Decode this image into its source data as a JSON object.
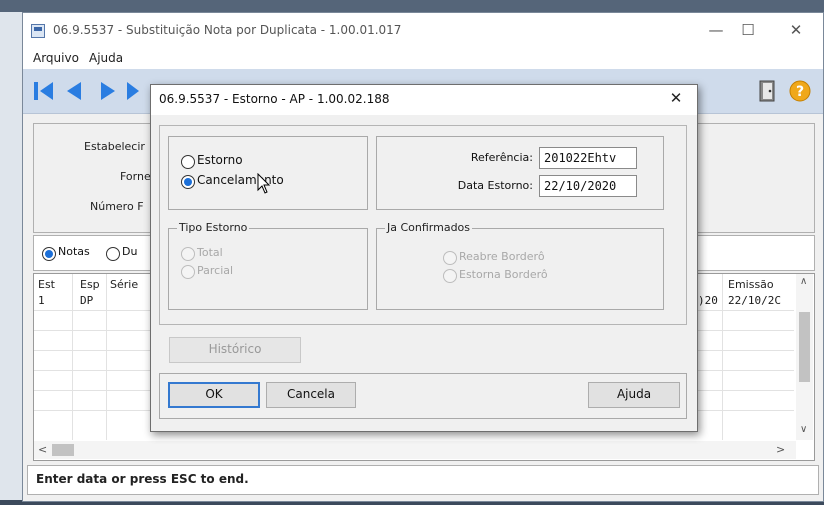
{
  "main_window": {
    "title": "06.9.5537 - Substituição Nota por Duplicata - 1.00.01.017",
    "menu": [
      "Arquivo",
      "Ajuda"
    ],
    "form_labels": [
      "Estabelecimento",
      "Fornecedor",
      "Número"
    ],
    "form_labels_visible": [
      "Estabelecir",
      "Forne",
      "Número F"
    ],
    "radio_options": [
      "Notas",
      "Du"
    ],
    "grid": {
      "headers": [
        "Est",
        "Esp",
        "Série",
        "Emissão"
      ],
      "row": {
        "est": "1",
        "esp": "DP",
        "partial_date": ")20",
        "emissao": "22/10/2C"
      }
    },
    "status": "Enter data or press ESC to end."
  },
  "dialog": {
    "title": "06.9.5537 - Estorno - AP - 1.00.02.188",
    "close": "✕",
    "options": [
      {
        "label": "Estorno",
        "checked": false
      },
      {
        "label": "Cancelamento",
        "checked": true
      }
    ],
    "referencia": {
      "label": "Referência:",
      "value": "201022Ehtv"
    },
    "data_estorno": {
      "label": "Data Estorno:",
      "value": "22/10/2020"
    },
    "tipo_estorno": {
      "legend": "Tipo Estorno",
      "options": [
        "Total",
        "Parcial"
      ]
    },
    "ja_confirmados": {
      "legend": "Ja Confirmados",
      "options": [
        "Reabre Borderô",
        "Estorna Borderô"
      ]
    },
    "historico_button": "Histórico",
    "ok_button": "OK",
    "cancel_button": "Cancela",
    "help_button": "Ajuda"
  },
  "colors": {
    "accent": "#1b6fd8",
    "toolbar": "#cfdbeb",
    "help_icon": "#f0a81a"
  }
}
